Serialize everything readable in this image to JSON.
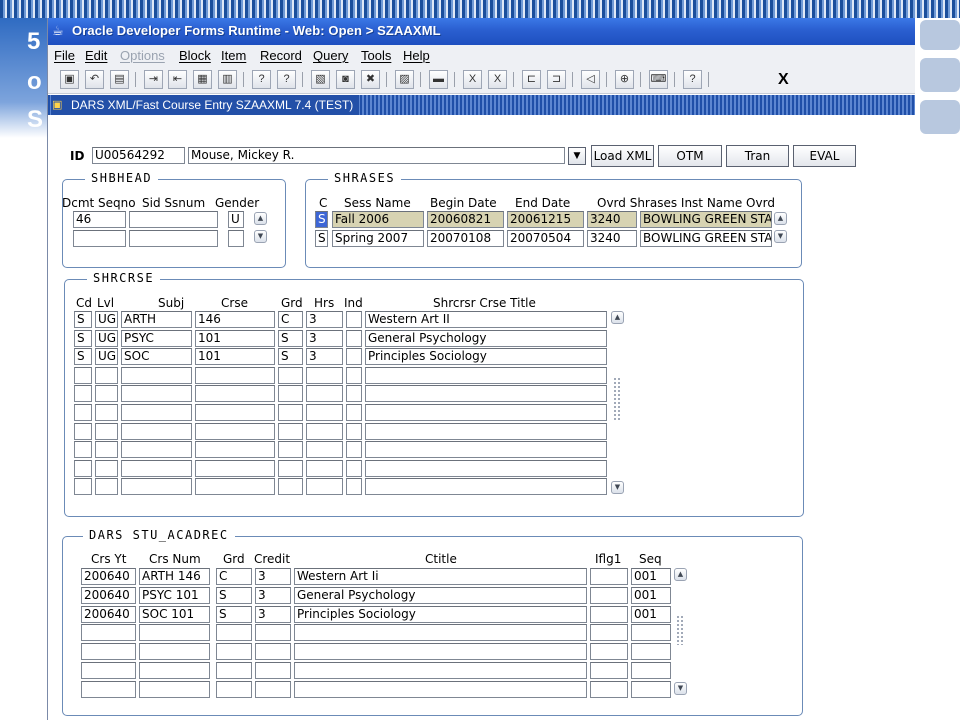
{
  "slide": {
    "letters": [
      "5",
      "o",
      "S"
    ]
  },
  "window": {
    "title": "Oracle Developer Forms Runtime - Web:  Open > SZAAXML"
  },
  "menu": [
    {
      "label": "File",
      "enabled": true
    },
    {
      "label": "Edit",
      "enabled": true
    },
    {
      "label": "Options",
      "enabled": false
    },
    {
      "label": "Block",
      "enabled": true
    },
    {
      "label": "Item",
      "enabled": true
    },
    {
      "label": "Record",
      "enabled": true
    },
    {
      "label": "Query",
      "enabled": true
    },
    {
      "label": "Tools",
      "enabled": true
    },
    {
      "label": "Help",
      "enabled": true
    }
  ],
  "toolbar": {
    "icons": [
      "save-icon",
      "rollback-icon",
      "print-icon",
      "insert-record-icon",
      "remove-record-icon",
      "lock-record-icon",
      "duplicate-icon",
      "enter-query-icon",
      "execute-query-icon",
      "count-icon",
      "database-icon",
      "delete-icon",
      "clipboard-icon",
      "printer-icon",
      "excel-icon",
      "excel-export-icon",
      "previous-block-icon",
      "next-block-icon",
      "speaker-icon",
      "target-icon",
      "keyboard-icon",
      "help-icon"
    ],
    "close_label": "X"
  },
  "form": {
    "title": "DARS XML/Fast Course Entry  SZAAXML  7.4  (TEST)"
  },
  "header": {
    "id_label": "ID",
    "id_value": "U00564292",
    "name_value": "Mouse, Mickey R.",
    "buttons": [
      "Load XML",
      "OTM",
      "Tran",
      "EVAL"
    ]
  },
  "shbhead": {
    "title": "SHBHEAD",
    "columns": [
      "Dcmt Seqno",
      "Sid Ssnum",
      "Gender"
    ],
    "rows": [
      {
        "seqno": "46",
        "ssnum": "",
        "gender": "U"
      },
      {
        "seqno": "",
        "ssnum": "",
        "gender": ""
      }
    ]
  },
  "shrases": {
    "title": "SHRASES",
    "columns": [
      "C",
      "Sess Name",
      "Begin Date",
      "End Date",
      "Ovrd Shrases Inst Name Ovrd"
    ],
    "rows": [
      {
        "c": "S",
        "sess": "Fall 2006",
        "begin": "20060821",
        "end": "20061215",
        "ovrd": "3240",
        "inst": "BOWLING GREEN STA"
      },
      {
        "c": "S",
        "sess": "Spring 2007",
        "begin": "20070108",
        "end": "20070504",
        "ovrd": "3240",
        "inst": "BOWLING GREEN STA"
      }
    ]
  },
  "shrcrse": {
    "title": "SHRCRSE",
    "columns": [
      "Cd",
      "Lvl",
      "Subj",
      "Crse",
      "Grd",
      "Hrs",
      "Ind",
      "Shrcrsr Crse Title"
    ],
    "rows": [
      {
        "cd": "S",
        "lvl": "UG",
        "subj": "ARTH",
        "crse": "146",
        "grd": "C",
        "hrs": "3",
        "ind": "",
        "title": "Western Art II"
      },
      {
        "cd": "S",
        "lvl": "UG",
        "subj": "PSYC",
        "crse": "101",
        "grd": "S",
        "hrs": "3",
        "ind": "",
        "title": "General Psychology"
      },
      {
        "cd": "S",
        "lvl": "UG",
        "subj": "SOC",
        "crse": "101",
        "grd": "S",
        "hrs": "3",
        "ind": "",
        "title": "Principles Sociology"
      },
      {
        "cd": "",
        "lvl": "",
        "subj": "",
        "crse": "",
        "grd": "",
        "hrs": "",
        "ind": "",
        "title": ""
      },
      {
        "cd": "",
        "lvl": "",
        "subj": "",
        "crse": "",
        "grd": "",
        "hrs": "",
        "ind": "",
        "title": ""
      },
      {
        "cd": "",
        "lvl": "",
        "subj": "",
        "crse": "",
        "grd": "",
        "hrs": "",
        "ind": "",
        "title": ""
      },
      {
        "cd": "",
        "lvl": "",
        "subj": "",
        "crse": "",
        "grd": "",
        "hrs": "",
        "ind": "",
        "title": ""
      },
      {
        "cd": "",
        "lvl": "",
        "subj": "",
        "crse": "",
        "grd": "",
        "hrs": "",
        "ind": "",
        "title": ""
      },
      {
        "cd": "",
        "lvl": "",
        "subj": "",
        "crse": "",
        "grd": "",
        "hrs": "",
        "ind": "",
        "title": ""
      },
      {
        "cd": "",
        "lvl": "",
        "subj": "",
        "crse": "",
        "grd": "",
        "hrs": "",
        "ind": "",
        "title": ""
      }
    ]
  },
  "acadrec": {
    "title": "DARS  STU_ACADREC",
    "columns": [
      "Crs Yt",
      "Crs Num",
      "Grd",
      "Credit",
      "Ctitle",
      "Iflg1",
      "Seq"
    ],
    "rows": [
      {
        "yt": "200640",
        "num": "ARTH 146",
        "grd": "C",
        "credit": "3",
        "ctitle": "Western Art Ii",
        "iflg": "",
        "seq": "001"
      },
      {
        "yt": "200640",
        "num": "PSYC 101",
        "grd": "S",
        "credit": "3",
        "ctitle": "General Psychology",
        "iflg": "",
        "seq": "001"
      },
      {
        "yt": "200640",
        "num": "SOC  101",
        "grd": "S",
        "credit": "3",
        "ctitle": "Principles Sociology",
        "iflg": "",
        "seq": "001"
      },
      {
        "yt": "",
        "num": "",
        "grd": "",
        "credit": "",
        "ctitle": "",
        "iflg": "",
        "seq": ""
      },
      {
        "yt": "",
        "num": "",
        "grd": "",
        "credit": "",
        "ctitle": "",
        "iflg": "",
        "seq": ""
      },
      {
        "yt": "",
        "num": "",
        "grd": "",
        "credit": "",
        "ctitle": "",
        "iflg": "",
        "seq": ""
      },
      {
        "yt": "",
        "num": "",
        "grd": "",
        "credit": "",
        "ctitle": "",
        "iflg": "",
        "seq": ""
      }
    ]
  }
}
